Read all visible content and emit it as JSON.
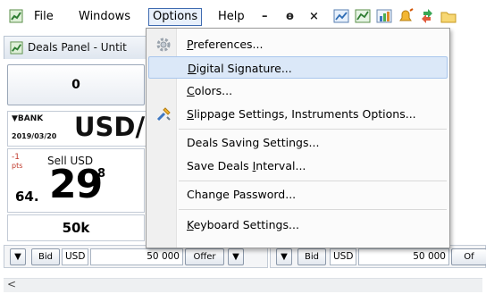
{
  "menubar": {
    "file": "File",
    "windows": "Windows",
    "options": "Options",
    "help": "Help",
    "minimize": "–",
    "restore": "ɵ",
    "close": "×"
  },
  "panel": {
    "title": "Deals Panel - Untit",
    "zero_value": "0",
    "bank_tag": "▼BANK",
    "bank_date": "2019/03/20",
    "symbol": "USD/",
    "pts_value": "-1",
    "pts_label": "pts",
    "sell_label": "Sell USD",
    "price_int": "64.",
    "price_main": "29",
    "price_sup": "8",
    "amount": "50k"
  },
  "trade_bar_left": {
    "arrow": "▼",
    "bid": "Bid",
    "currency": "USD",
    "qty": "50 000",
    "offer": "Offer",
    "arrow2": "▼"
  },
  "trade_bar_right": {
    "arrow": "▼",
    "bid": "Bid",
    "currency": "USD",
    "qty": "50 000",
    "offer": "Of"
  },
  "scroll": {
    "left_arrow": "<"
  },
  "options_menu": {
    "items": [
      {
        "label": "Preferences...",
        "mnemonic_index": 0
      },
      {
        "label": "Digital Signature...",
        "mnemonic_index": 0
      },
      {
        "label": "Colors...",
        "mnemonic_index": 0
      },
      {
        "label": "Slippage Settings, Instruments Options...",
        "mnemonic_index": 0
      },
      {
        "label": "Deals Saving Settings...",
        "mnemonic_index": -1
      },
      {
        "label": "Save Deals Interval...",
        "mnemonic_index": 11
      },
      {
        "label": "Change Password...",
        "mnemonic_index": -1
      },
      {
        "label": "Keyboard Settings...",
        "mnemonic_index": 0
      }
    ],
    "highlighted": "Digital Signature..."
  },
  "colors": {
    "menu_highlight_bg": "#dbe8f8",
    "menu_highlight_border": "#a9c6ec",
    "active_menu_border": "#3f6bb0",
    "pts_red": "#c0392b"
  }
}
